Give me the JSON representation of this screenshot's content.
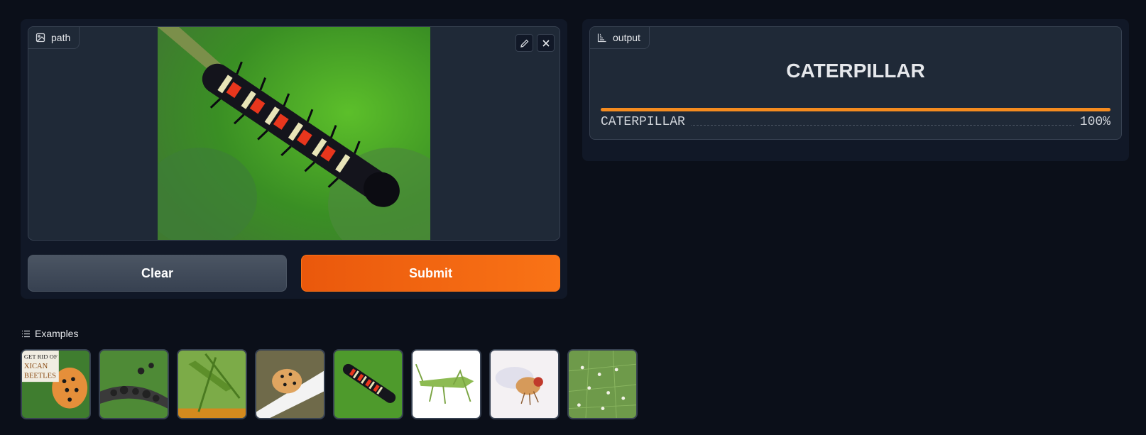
{
  "input": {
    "label": "path",
    "label_icon": "image-icon",
    "edit_icon": "pencil-icon",
    "close_icon": "close-icon"
  },
  "buttons": {
    "clear": "Clear",
    "submit": "Submit"
  },
  "output": {
    "label": "output",
    "label_icon": "bar-chart-icon",
    "top_class": "CATERPILLAR",
    "confidences": [
      {
        "label": "CATERPILLAR",
        "value": "100%",
        "fraction": 1.0
      }
    ]
  },
  "examples": {
    "header": "Examples",
    "header_icon": "list-icon",
    "items": [
      {
        "name": "example-mexican-beetles",
        "caption_lines": [
          "GET RID OF",
          "XICAN",
          "BEETLES"
        ]
      },
      {
        "name": "example-aphids"
      },
      {
        "name": "example-grasshopper"
      },
      {
        "name": "example-ladybug"
      },
      {
        "name": "example-caterpillar"
      },
      {
        "name": "example-katydid"
      },
      {
        "name": "example-fruit-fly"
      },
      {
        "name": "example-whiteflies"
      }
    ]
  },
  "colors": {
    "accent": "#f97316",
    "background": "#0b0f19",
    "panel": "#111827",
    "block": "#1f2937"
  }
}
